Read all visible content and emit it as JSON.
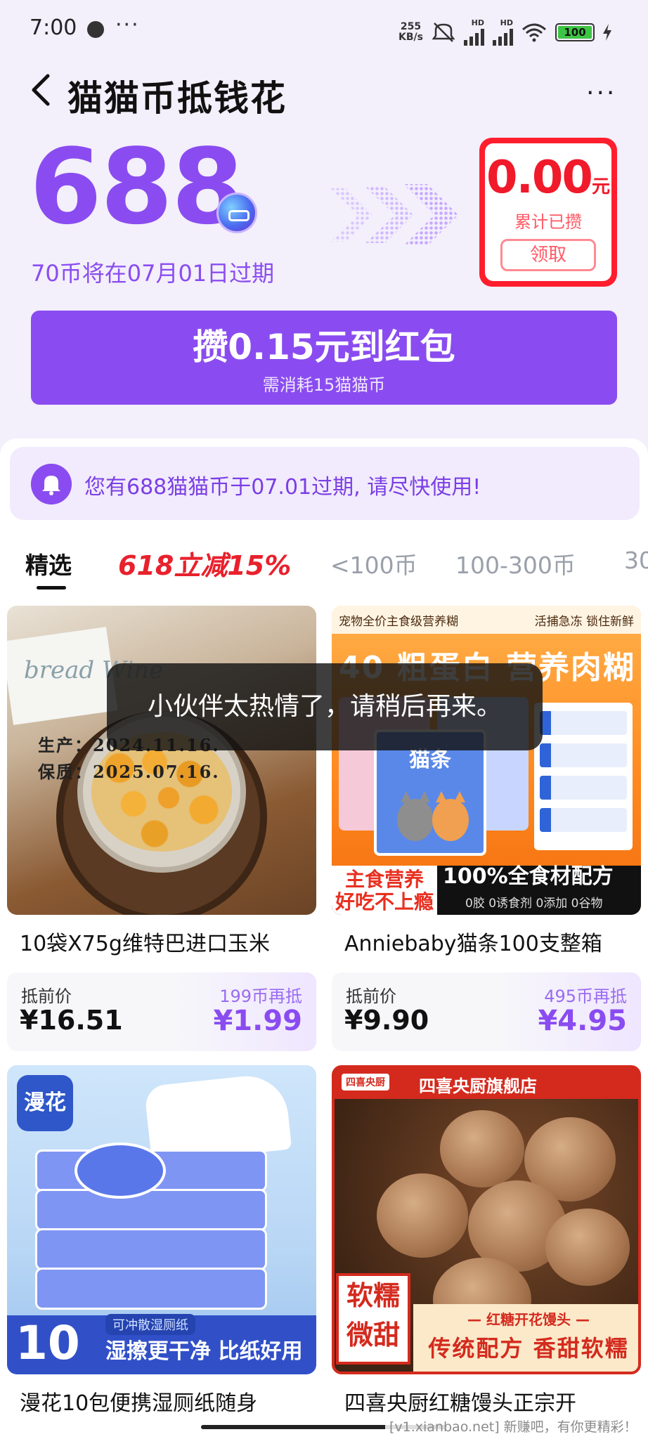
{
  "status_bar": {
    "time": "7:00",
    "more": "···",
    "net_speed_value": "255",
    "net_speed_unit": "KB/s",
    "hd_1": "HD",
    "hd_2": "HD",
    "battery": "100"
  },
  "header": {
    "title": "猫猫币抵钱花",
    "more": "···"
  },
  "balance": {
    "amount": "688",
    "expire_note": "70币将在07月01日过期"
  },
  "earned_card": {
    "amount": "0.00",
    "unit": "元",
    "label": "累计已攒",
    "claim_label": "领取"
  },
  "redeem_button": {
    "main_label": "攒0.15元到红包",
    "sub_label": "需消耗15猫猫币"
  },
  "notice": {
    "text": "您有688猫猫币于07.01过期, 请尽快使用!"
  },
  "tabs": [
    {
      "label": "精选"
    },
    {
      "label": "618立减15%"
    },
    {
      "label": "<100币"
    },
    {
      "label": "100-300币"
    },
    {
      "label": "30"
    }
  ],
  "toast": {
    "text": "小伙伴太热情了，请稍后再来。"
  },
  "products": [
    {
      "title": "10袋X75g维特巴进口玉米",
      "price_label": "抵前价",
      "price": "¥16.51",
      "coin_note": "199币再抵",
      "final_price": "¥1.99",
      "image_text": {
        "bag": "bread Wine",
        "stamp": "生产：2024.11.16.\n保质：2025.07.16."
      }
    },
    {
      "title": "Anniebaby猫条100支整箱",
      "price_label": "抵前价",
      "price": "¥9.90",
      "coin_note": "495币再抵",
      "final_price": "¥4.95",
      "image_text": {
        "top_left": "宠物全价主食级营养糊",
        "top_right": "活捕急冻 锁住新鲜",
        "headline": "40 粗蛋白 营养肉糊",
        "pack_label": "猫条",
        "bottom_left": "主食营养\n好吃不上瘾",
        "bottom_right": "100%全食材配方",
        "bottom_sub": "0胶 0诱食剂 0添加 0谷物"
      }
    },
    {
      "title": "漫花10包便携湿厕纸随身",
      "image_text": {
        "brand": "漫花",
        "count": "10",
        "tag": "可冲散湿厕纸",
        "slogan": "湿擦更干净 比纸好用"
      }
    },
    {
      "title": "四喜央厨红糖馒头正宗开",
      "image_text": {
        "shop": "四喜央厨旗舰店",
        "shop_badge": "四喜央厨",
        "side_tag": "软糯\n微甜",
        "banner_top": "— 红糖开花馒头 —",
        "banner_main": "传统配方 香甜软糯"
      }
    }
  ],
  "watermark": "[v1.xianbao.net] 新赚吧，有你更精彩！",
  "colors": {
    "accent": "#8a4cf0",
    "red": "#ff1e2d",
    "background": "#f3effb"
  }
}
